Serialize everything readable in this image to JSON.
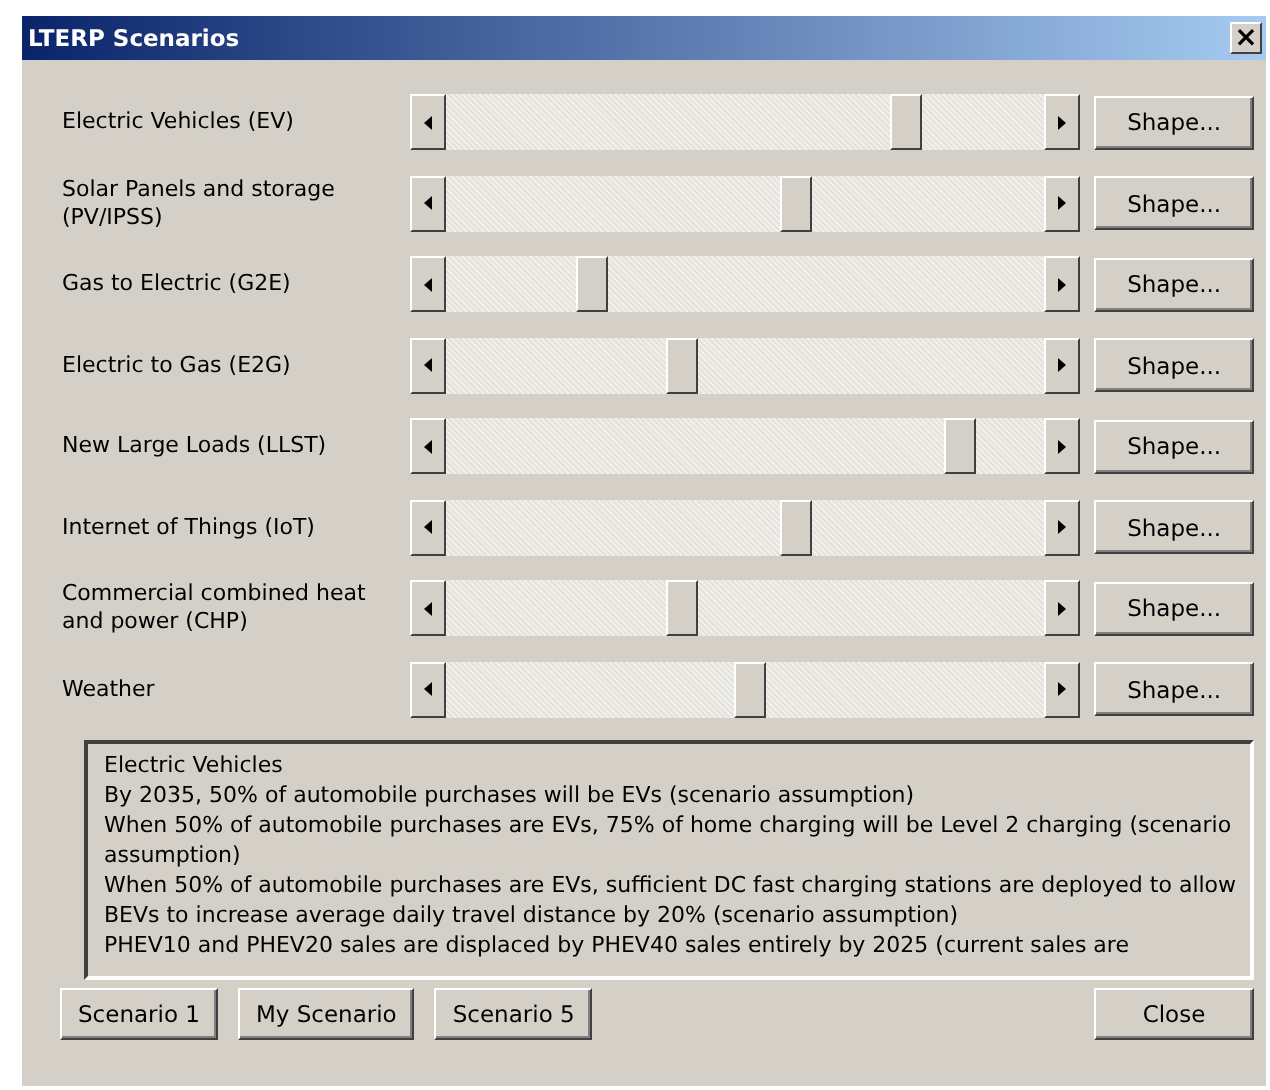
{
  "window": {
    "title": "LTERP Scenarios",
    "close": "×"
  },
  "scenarios": [
    {
      "label": "Electric Vehicles (EV)",
      "level": 0.785,
      "button": "Shape..."
    },
    {
      "label": "Solar Panels and storage (PV/IPSS)",
      "level": 0.59,
      "button": "Shape..."
    },
    {
      "label": "Gas to Electric (G2E)",
      "level": 0.23,
      "button": "Shape..."
    },
    {
      "label": "Electric to Gas (E2G)",
      "level": 0.39,
      "button": "Shape..."
    },
    {
      "label": "New Large Loads (LLST)",
      "level": 0.88,
      "button": "Shape..."
    },
    {
      "label": "Internet of Things (IoT)",
      "level": 0.59,
      "button": "Shape..."
    },
    {
      "label": "Commercial combined heat and power (CHP)",
      "level": 0.39,
      "button": "Shape..."
    },
    {
      "label": "Weather",
      "level": 0.51,
      "button": "Shape..."
    }
  ],
  "description": [
    "Electric Vehicles",
    "By 2035, 50% of automobile purchases will be EVs (scenario assumption)",
    "When 50% of automobile purchases are EVs, 75% of home charging will be Level 2 charging (scenario assumption)",
    "When 50% of automobile purchases are EVs, sufficient DC fast charging stations are deployed to allow BEVs to increase average daily travel distance by 20% (scenario assumption)",
    "PHEV10 and PHEV20 sales are displaced by PHEV40 sales entirely by 2025 (current sales are"
  ],
  "buttons": [
    "Scenario 1",
    "My Scenario",
    "Scenario 5"
  ],
  "close_button": "Close"
}
